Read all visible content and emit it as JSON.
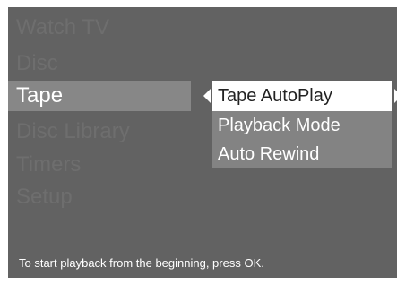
{
  "main_menu": {
    "items": [
      {
        "label": "Watch TV"
      },
      {
        "label": "Disc"
      },
      {
        "label": "Tape"
      },
      {
        "label": "Disc Library"
      },
      {
        "label": "Timers"
      },
      {
        "label": "Setup"
      }
    ],
    "selected_index": 2
  },
  "submenu": {
    "items": [
      {
        "label": "Tape AutoPlay"
      },
      {
        "label": "Playback Mode"
      },
      {
        "label": "Auto Rewind"
      }
    ],
    "selected_index": 0
  },
  "help_text": "To start playback from the beginning, press OK.",
  "colors": {
    "background": "#626262",
    "dim_text": "#6e6e6e",
    "selected_bar": "#878787",
    "submenu_bg": "#838383",
    "highlight": "#ffffff"
  },
  "icons": {
    "left": "triangle-left-icon",
    "right": "triangle-right-icon"
  }
}
